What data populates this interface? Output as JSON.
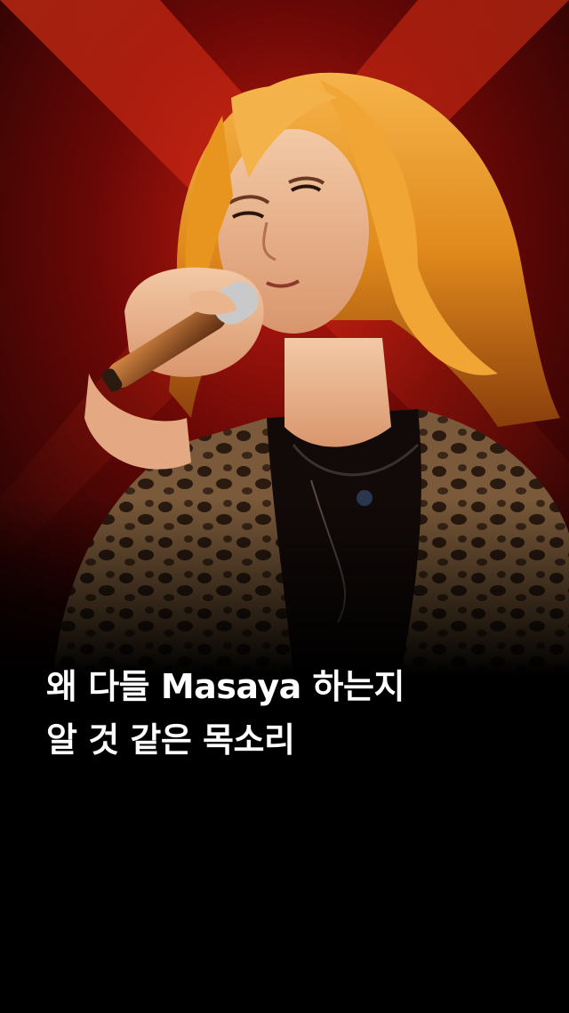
{
  "post": {
    "caption_lines": [
      "왜 다들 Masaya 하는지",
      "알 것 같은 목소리"
    ]
  },
  "colors": {
    "background": "#000000",
    "stage_red": "#b0120f",
    "hair_orange": "#e8901e",
    "caption_text": "#ffffff"
  }
}
